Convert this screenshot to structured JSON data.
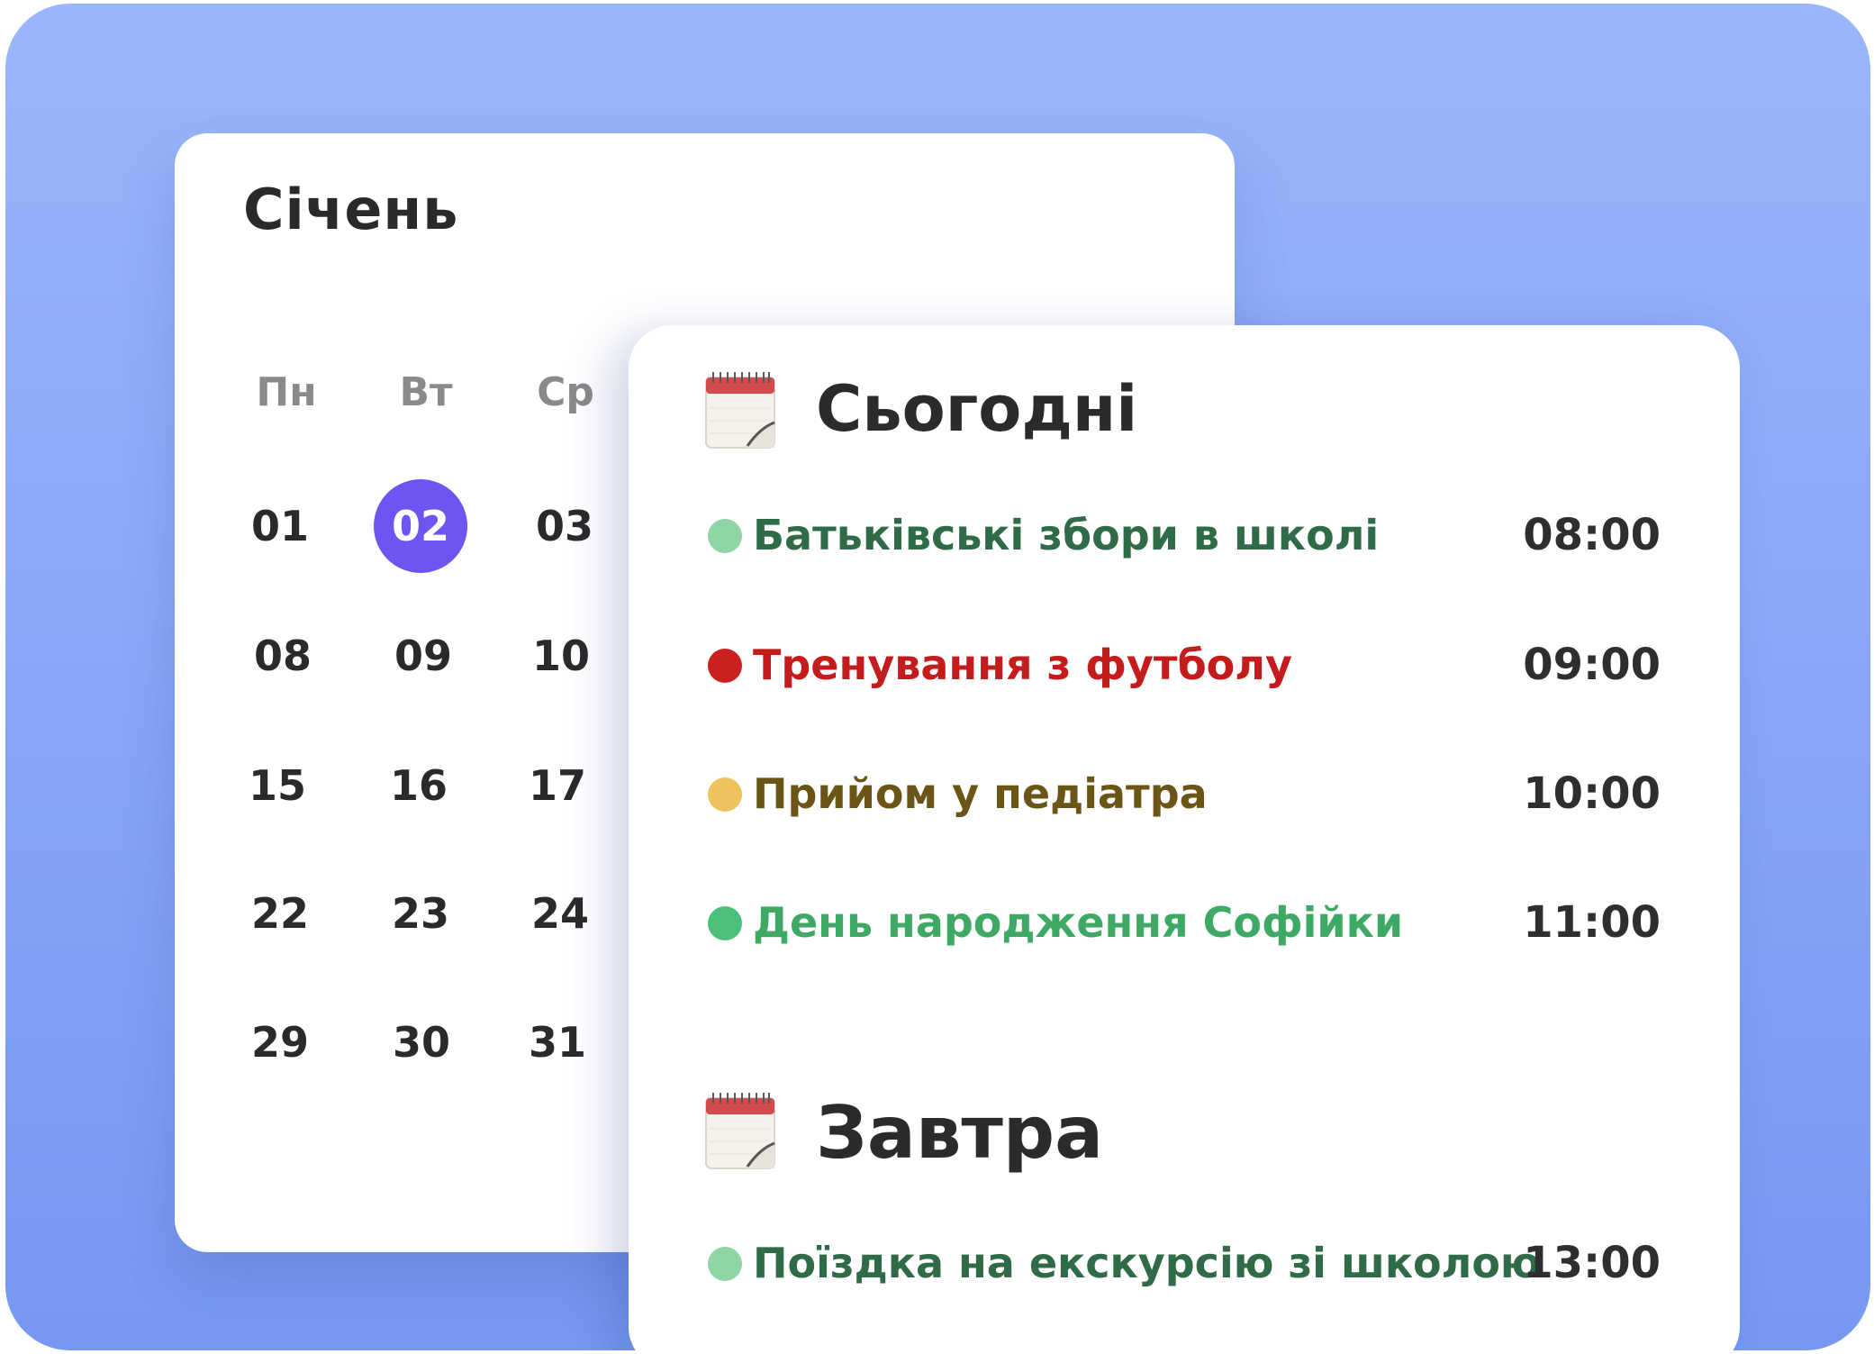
{
  "calendar": {
    "month": "Січень",
    "weekdays": [
      "Пн",
      "Вт",
      "Ср"
    ],
    "rows": [
      [
        "01",
        "02",
        "03"
      ],
      [
        "08",
        "09",
        "10"
      ],
      [
        "15",
        "16",
        "17"
      ],
      [
        "22",
        "23",
        "24"
      ],
      [
        "29",
        "30",
        "31"
      ]
    ],
    "selected_day": "02",
    "accent": "#6e55f2"
  },
  "today": {
    "title": "Сьогодні",
    "icon": "calendar-icon",
    "events": [
      {
        "name": "Батьківські збори в школі",
        "time": "08:00",
        "dot": "#8fd5a6",
        "text_color": "#2f6b46"
      },
      {
        "name": "Тренування з футболу",
        "time": "09:00",
        "dot": "#cc1f1f",
        "text_color": "#c41c1c"
      },
      {
        "name": "Прийом у педіатра",
        "time": "10:00",
        "dot": "#eec35e",
        "text_color": "#6b5516"
      },
      {
        "name": "День народження Софійки",
        "time": "11:00",
        "dot": "#4cc07b",
        "text_color": "#3ea865"
      }
    ]
  },
  "tomorrow": {
    "title": "Завтра",
    "icon": "calendar-icon",
    "events": [
      {
        "name": "Поїздка на екскурсію зі школою",
        "time": "13:00",
        "dot": "#8fd5a6",
        "text_color": "#2f6b46"
      }
    ]
  }
}
